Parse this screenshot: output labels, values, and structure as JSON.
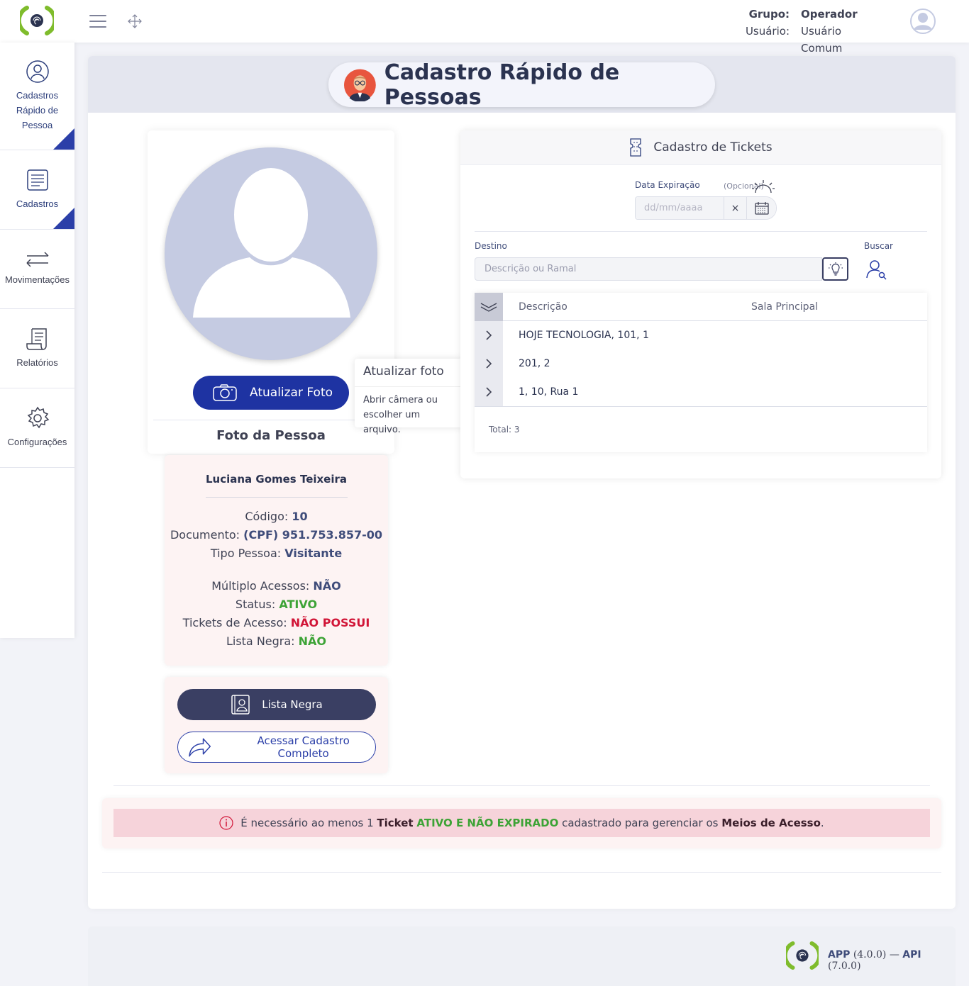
{
  "header": {
    "group_label": "Grupo:",
    "group_value": "Operador",
    "user_label": "Usuário:",
    "user_value": "Usuário Comum"
  },
  "sidebar": {
    "items": [
      {
        "label_lines": [
          "Cadastros",
          "Rápido de",
          "Pessoa"
        ],
        "active": true
      },
      {
        "label": "Cadastros",
        "active": true
      },
      {
        "label": "Movimentações",
        "active": false
      },
      {
        "label": "Relatórios",
        "active": false
      },
      {
        "label": "Configurações",
        "active": false
      }
    ]
  },
  "page": {
    "title": "Cadastro Rápido de Pessoas"
  },
  "photo": {
    "button_label": "Atualizar Foto",
    "caption": "Foto da Pessoa"
  },
  "tooltip": {
    "title": "Atualizar foto",
    "body_lines": [
      "Abrir câmera ou",
      "escolher um arquivo."
    ]
  },
  "person": {
    "name": "Luciana Gomes Teixeira",
    "codigo_label": "Código:",
    "codigo": "10",
    "documento_label": "Documento:",
    "documento": "(CPF) 951.753.857-00",
    "tipo_label": "Tipo Pessoa:",
    "tipo": "Visitante",
    "multiplo_label": "Múltiplo Acessos:",
    "multiplo": "NÃO",
    "status_label": "Status:",
    "status": "ATIVO",
    "tickets_label": "Tickets de Acesso:",
    "tickets": "NÃO POSSUI",
    "lista_label": "Lista Negra:",
    "lista": "NÃO"
  },
  "actions": {
    "lista_negra": "Lista Negra",
    "cadastro_completo": "Acessar Cadastro Completo"
  },
  "tickets": {
    "title": "Cadastro de Tickets",
    "date_label": "Data Expiração",
    "optional_label": "(Opcional)",
    "date_placeholder": "dd/mm/aaaa",
    "clear_symbol": "×",
    "destino_label": "Destino",
    "destino_placeholder": "Descrição ou Ramal",
    "buscar_label": "Buscar",
    "columns": [
      "Descrição",
      "Sala Principal"
    ],
    "rows": [
      {
        "descricao": "HOJE TECNOLOGIA, 101, 1",
        "sala": ""
      },
      {
        "descricao": "201, 2",
        "sala": ""
      },
      {
        "descricao": "1, 10, Rua 1",
        "sala": ""
      }
    ],
    "total": "Total: 3"
  },
  "alert": {
    "part1": "É necessário ao menos 1 ",
    "ticket": "Ticket",
    "status": "ATIVO E NÃO EXPIRADO",
    "part2": " cadastrado para gerenciar os ",
    "meios": "Meios de Acesso",
    "end": "."
  },
  "footer": {
    "app_label": "APP",
    "app_version": "(4.0.0)",
    "sep": "—",
    "api_label": "API",
    "api_version": "(7.0.0)"
  },
  "colors": {
    "primary": "#1e33a2",
    "dark": "#3a3f63",
    "logo_green": "#7fbc2c",
    "active_green": "#3da336",
    "danger_red": "#d11537",
    "alert_bg": "#f6d3da"
  }
}
